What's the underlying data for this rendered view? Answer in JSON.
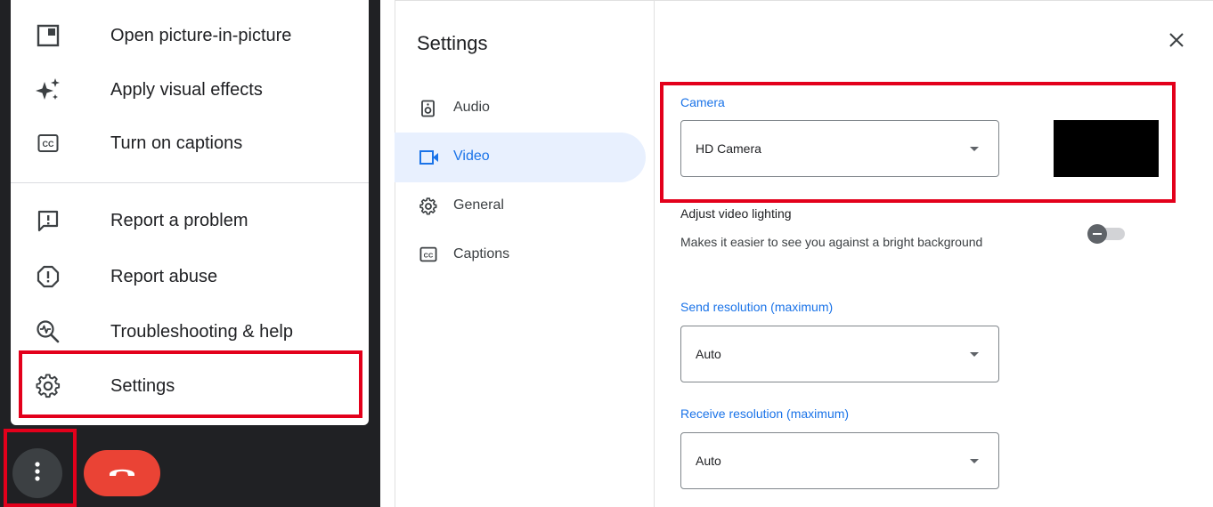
{
  "menu": {
    "items": [
      {
        "label": "Open picture-in-picture",
        "icon": "picture-in-picture-icon"
      },
      {
        "label": "Apply visual effects",
        "icon": "sparkle-icon"
      },
      {
        "label": "Turn on captions",
        "icon": "captions-icon"
      },
      {
        "label": "Report a problem",
        "icon": "report-problem-icon"
      },
      {
        "label": "Report abuse",
        "icon": "report-abuse-icon"
      },
      {
        "label": "Troubleshooting & help",
        "icon": "troubleshooting-icon"
      },
      {
        "label": "Settings",
        "icon": "gear-icon"
      }
    ]
  },
  "call_controls": {
    "more_options_icon": "more-vert-icon",
    "end_call_icon": "end-call-icon"
  },
  "settings": {
    "title": "Settings",
    "nav": [
      {
        "label": "Audio",
        "icon": "speaker-icon"
      },
      {
        "label": "Video",
        "icon": "video-camera-icon",
        "active": true
      },
      {
        "label": "General",
        "icon": "gear-icon"
      },
      {
        "label": "Captions",
        "icon": "captions-icon"
      }
    ],
    "camera": {
      "label": "Camera",
      "value": "HD Camera"
    },
    "lighting": {
      "title": "Adjust video lighting",
      "description": "Makes it easier to see you against a bright background",
      "enabled": false
    },
    "send_resolution": {
      "label": "Send resolution (maximum)",
      "value": "Auto"
    },
    "receive_resolution": {
      "label": "Receive resolution (maximum)",
      "value": "Auto"
    }
  },
  "colors": {
    "accent": "#1a73e8",
    "highlight": "#e3001b",
    "end_call": "#ea4335",
    "dark_bg": "#202124",
    "nav_active_bg": "#e8f0fe"
  }
}
